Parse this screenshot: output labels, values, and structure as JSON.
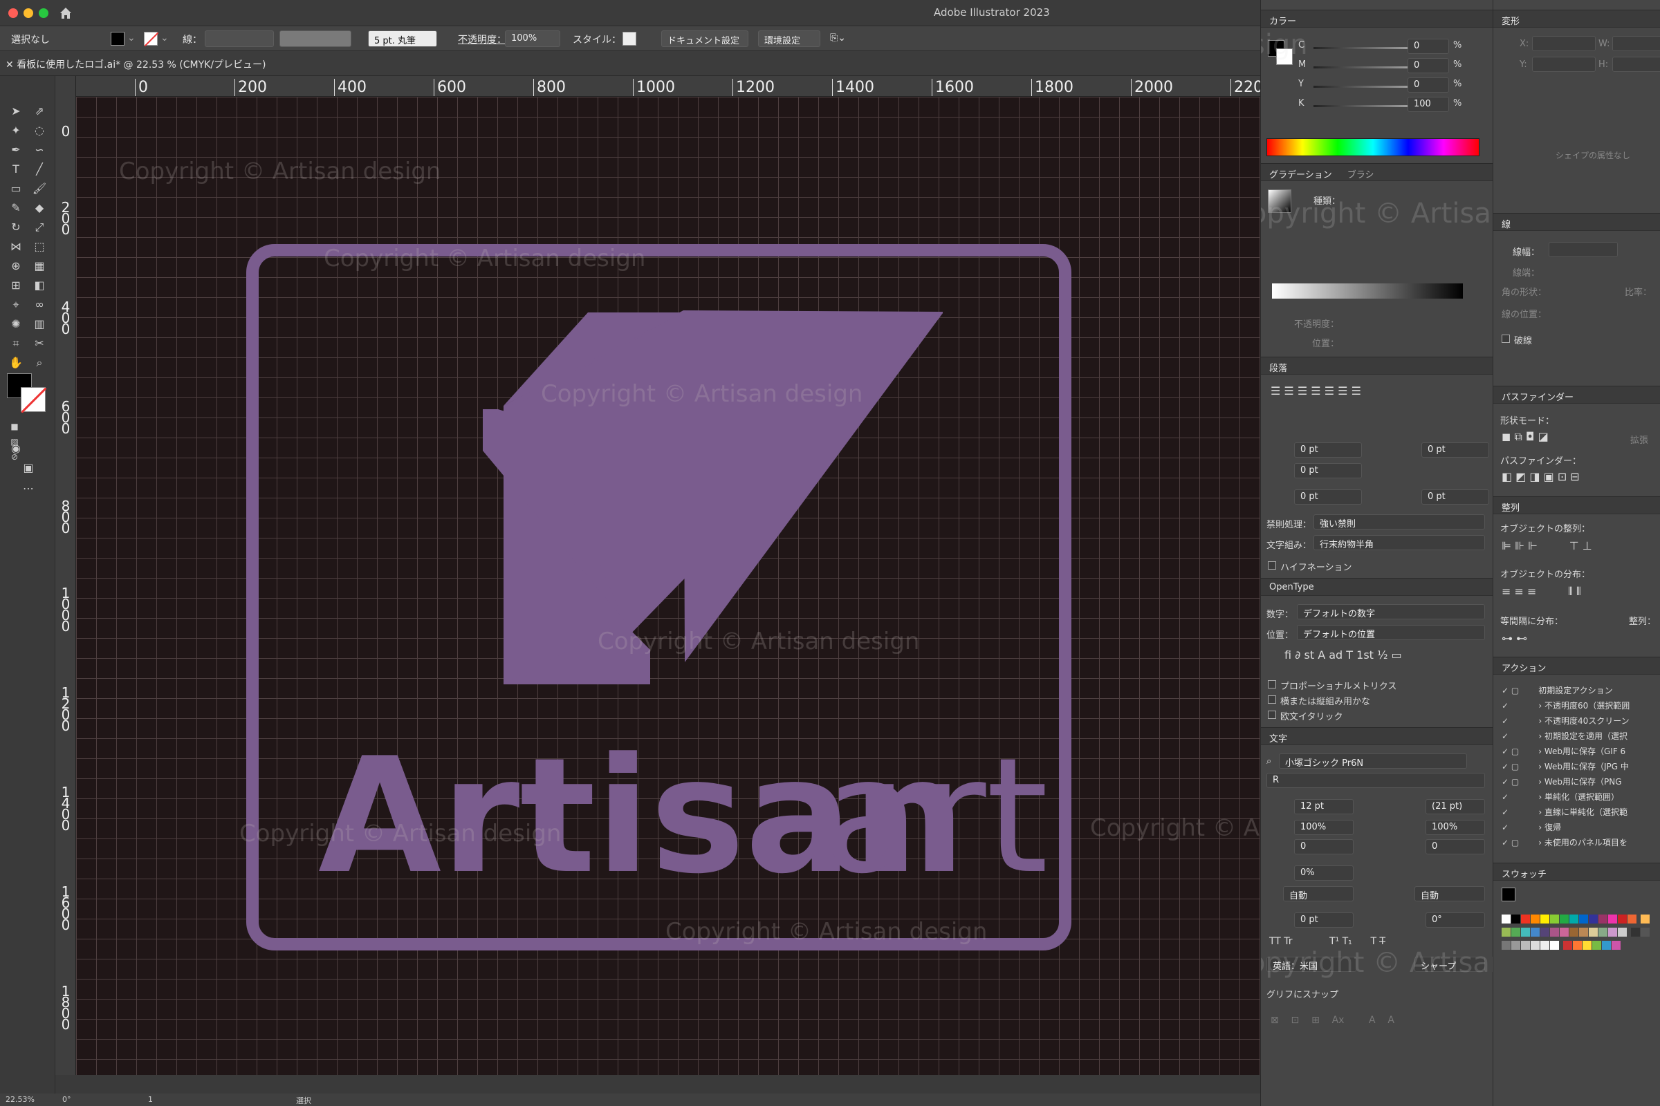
{
  "app": {
    "title": "Adobe Illustrator 2023"
  },
  "control_bar": {
    "selection": "選択なし",
    "stroke_label": "線：",
    "brush": "5 pt. 丸筆",
    "opacity_label": "不透明度：",
    "opacity_value": "100%",
    "style_label": "スタイル：",
    "doc_settings": "ドキュメント設定",
    "preferences": "環境設定"
  },
  "document": {
    "tab_title": "看板に使用したロゴ.ai* @ 22.53 % (CMYK/プレビュー)"
  },
  "rulers": {
    "top": [
      "0",
      "200",
      "400",
      "600",
      "800",
      "1000",
      "1200",
      "1400",
      "1600",
      "1800",
      "2000",
      "220"
    ],
    "left": [
      "0",
      "200",
      "400",
      "600",
      "800",
      "1000",
      "1200",
      "1400",
      "1600",
      "1800"
    ]
  },
  "artwork": {
    "logo_text_bold": "Artisan",
    "logo_text_light": "art",
    "logo_color": "#7a5c8e",
    "background_color": "#201617"
  },
  "watermark": "Copyright © Artisan design",
  "status_bar": {
    "zoom": "22.53%",
    "rotation": "0°",
    "page": "1",
    "tool": "選択"
  },
  "color_panel": {
    "title": "カラー",
    "channels": [
      {
        "name": "C",
        "value": "0",
        "unit": "%"
      },
      {
        "name": "M",
        "value": "0",
        "unit": "%"
      },
      {
        "name": "Y",
        "value": "0",
        "unit": "%"
      },
      {
        "name": "K",
        "value": "100",
        "unit": "%"
      }
    ]
  },
  "transform_panel": {
    "title": "変形",
    "no_shape": "シェイプの属性なし",
    "x_label": "X:",
    "y_label": "Y:",
    "w_label": "W:",
    "h_label": "H:"
  },
  "gradient_panel": {
    "tab1": "グラデーション",
    "tab2": "ブラシ",
    "type_label": "種類：",
    "opacity_label": "不透明度：",
    "position_label": "位置："
  },
  "stroke_panel": {
    "title": "線",
    "width_label": "線幅：",
    "cap_label": "線端：",
    "corner_label": "角の形状：",
    "align_label": "線の位置：",
    "ratio_label": "比率：",
    "dashed_label": "破線"
  },
  "paragraph_panel": {
    "title": "段落",
    "indent_values": [
      "0 pt",
      "0 pt",
      "0 pt",
      "0 pt",
      "0 pt"
    ],
    "kinsoku_label": "禁則処理：",
    "kinsoku_value": "強い禁則",
    "mojikumi_label": "文字組み：",
    "mojikumi_value": "行末約物半角",
    "hyphenation": "ハイフネーション"
  },
  "opentype_panel": {
    "title": "OpenType",
    "figure_label": "数字：",
    "figure_value": "デフォルトの数字",
    "position_label": "位置：",
    "position_value": "デフォルトの位置",
    "options": [
      "プロポーショナルメトリクス",
      "横または縦組み用かな",
      "欧文イタリック"
    ]
  },
  "character_panel": {
    "title": "文字",
    "font": "小塚ゴシック Pr6N",
    "style": "R",
    "size": "12 pt",
    "leading": "(21 pt)",
    "vscale": "100%",
    "hscale": "100%",
    "kerning": "0",
    "tracking": "0",
    "tsume": "0%",
    "aki_left": "自動",
    "aki_right": "自動",
    "baseline": "0 pt",
    "rotation": "0°",
    "language": "英語：米国",
    "antialias": "シャープ",
    "snap": "グリフにスナップ"
  },
  "pathfinder_panel": {
    "title": "パスファインダー",
    "shape_modes": "形状モード：",
    "pathfinders": "パスファインダー：",
    "expand": "拡張"
  },
  "align_panel": {
    "title": "整列",
    "align_objects": "オブジェクトの整列：",
    "distribute_objects": "オブジェクトの分布：",
    "distribute_spacing": "等間隔に分布：",
    "align_to": "整列："
  },
  "actions_panel": {
    "title": "アクション",
    "items": [
      "初期設定アクション",
      "不透明度60（選択範囲",
      "不透明度40スクリーン",
      "初期設定を適用（選択",
      "Web用に保存（GIF 6",
      "Web用に保存（JPG 中",
      "Web用に保存（PNG",
      "単純化（選択範囲）",
      "直線に単純化（選択範",
      "復帰",
      "未使用のパネル項目を"
    ]
  },
  "swatches_panel": {
    "title": "スウォッチ"
  }
}
